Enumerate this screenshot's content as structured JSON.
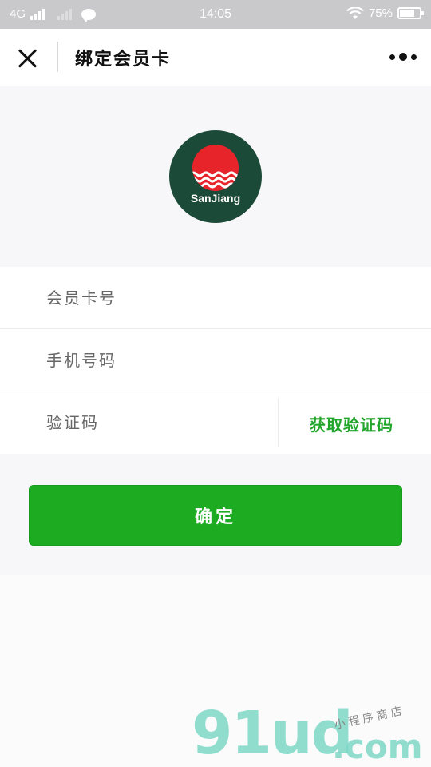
{
  "status_bar": {
    "network": "4G",
    "time": "14:05",
    "battery_percent": "75%",
    "battery_level": 0.75
  },
  "nav": {
    "title": "绑定会员卡"
  },
  "logo": {
    "text": "SanJiang",
    "background_color": "#1c4a38",
    "sun_color": "#e8242b"
  },
  "form": {
    "card_number_placeholder": "会员卡号",
    "phone_placeholder": "手机号码",
    "code_placeholder": "验证码",
    "get_code_label": "获取验证码"
  },
  "confirm": {
    "label": "确定",
    "color": "#1dab22"
  },
  "watermark": {
    "main": "91ud",
    "dot_com": ".com",
    "sub": "小程序商店"
  }
}
